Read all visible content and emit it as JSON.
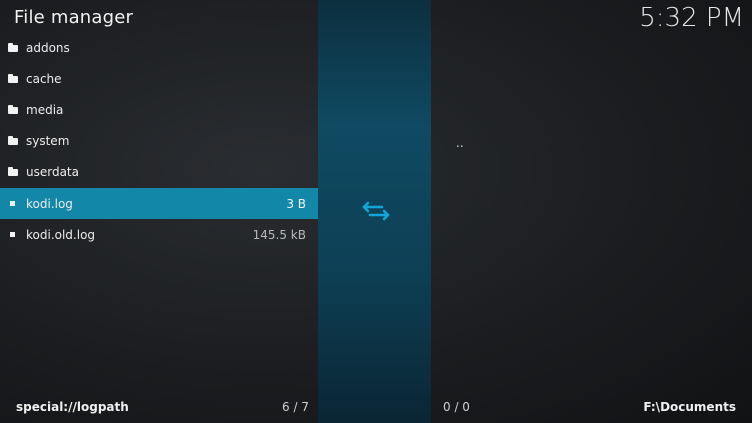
{
  "header": {
    "title": "File manager",
    "clock": "5:32 PM"
  },
  "left_pane": {
    "items": [
      {
        "name": "addons",
        "type": "folder",
        "size": ""
      },
      {
        "name": "cache",
        "type": "folder",
        "size": ""
      },
      {
        "name": "media",
        "type": "folder",
        "size": ""
      },
      {
        "name": "system",
        "type": "folder",
        "size": ""
      },
      {
        "name": "userdata",
        "type": "folder",
        "size": ""
      },
      {
        "name": "kodi.log",
        "type": "file",
        "size": "3 B",
        "selected": true
      },
      {
        "name": "kodi.old.log",
        "type": "file",
        "size": "145.5 kB"
      }
    ],
    "path": "special://logpath",
    "count": "6 / 7"
  },
  "right_pane": {
    "items": [
      {
        "name": ".."
      }
    ],
    "path": "F:\\Documents",
    "count": "0 / 0"
  },
  "colors": {
    "accent": "#1287a8",
    "swap_icon": "#12a6d8"
  },
  "icons": {
    "folder": "folder-icon",
    "file": "file-icon",
    "swap": "swap-arrows-icon"
  }
}
